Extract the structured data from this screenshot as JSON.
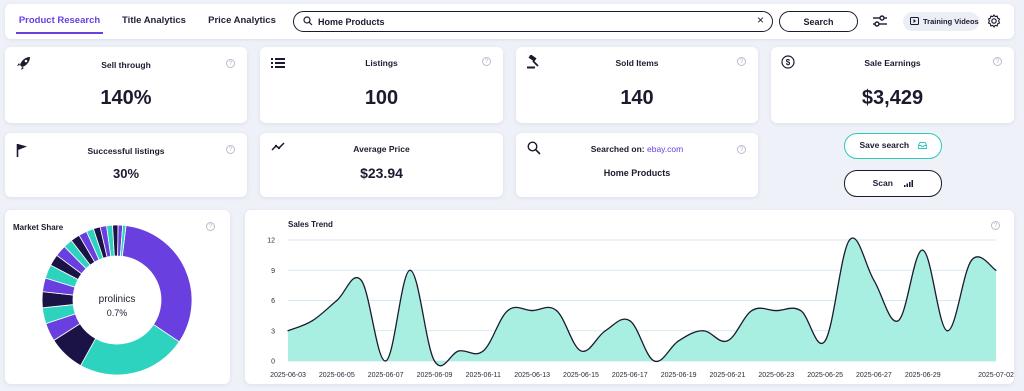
{
  "tabs": [
    {
      "label": "Product Research",
      "active": true
    },
    {
      "label": "Title Analytics",
      "active": false
    },
    {
      "label": "Price Analytics",
      "active": false
    }
  ],
  "search": {
    "value": "Home Products",
    "button_label": "Search"
  },
  "training_label": "Training Videos",
  "stats": {
    "sell_through": {
      "label": "Sell through",
      "value": "140%"
    },
    "listings": {
      "label": "Listings",
      "value": "100"
    },
    "sold_items": {
      "label": "Sold Items",
      "value": "140"
    },
    "sale_earnings": {
      "label": "Sale Earnings",
      "value": "$3,429"
    },
    "successful_listings": {
      "label": "Successful listings",
      "value": "30%"
    },
    "average_price": {
      "label": "Average Price",
      "value": "$23.94"
    },
    "searched_on": {
      "label": "Searched on:",
      "site": "ebay.com",
      "value": "Home Products"
    }
  },
  "save_search_label": "Save search",
  "scan_label": "Scan",
  "help_glyph": "?",
  "market_share": {
    "title": "Market Share",
    "center_name": "prolinics",
    "center_value": "0.7%",
    "slices": [
      {
        "value": 33,
        "color": "#6a3fe0"
      },
      {
        "value": 24,
        "color": "#2ed3bf"
      },
      {
        "value": 8,
        "color": "#1b1346"
      },
      {
        "value": 4,
        "color": "#6a3fe0"
      },
      {
        "value": 3.5,
        "color": "#2ed3bf"
      },
      {
        "value": 3.5,
        "color": "#1b1346"
      },
      {
        "value": 3,
        "color": "#6a3fe0"
      },
      {
        "value": 3,
        "color": "#2ed3bf"
      },
      {
        "value": 2.5,
        "color": "#1b1346"
      },
      {
        "value": 2.5,
        "color": "#6a3fe0"
      },
      {
        "value": 2,
        "color": "#2ed3bf"
      },
      {
        "value": 2,
        "color": "#1b1346"
      },
      {
        "value": 1.8,
        "color": "#6a3fe0"
      },
      {
        "value": 1.6,
        "color": "#2ed3bf"
      },
      {
        "value": 1.5,
        "color": "#1b1346"
      },
      {
        "value": 1.4,
        "color": "#6a3fe0"
      },
      {
        "value": 1.3,
        "color": "#2ed3bf"
      },
      {
        "value": 1.2,
        "color": "#1b1346"
      },
      {
        "value": 1.0,
        "color": "#6a3fe0"
      },
      {
        "value": 0.7,
        "color": "#2ed3bf"
      }
    ]
  },
  "chart_data": {
    "type": "area",
    "title": "Sales Trend",
    "ylim": [
      0,
      12
    ],
    "yticks": [
      0,
      3,
      6,
      9,
      12
    ],
    "grid": true,
    "fill_color": "#a8efe2",
    "line_color": "#1b1b2f",
    "x_labels": [
      "2025-06-03",
      "2025-06-05",
      "2025-06-07",
      "2025-06-09",
      "2025-06-11",
      "2025-06-13",
      "2025-06-15",
      "2025-06-17",
      "2025-06-19",
      "2025-06-21",
      "2025-06-23",
      "2025-06-25",
      "2025-06-27",
      "2025-06-29",
      "2025-07-02"
    ],
    "x": [
      "2025-06-03",
      "2025-06-04",
      "2025-06-05",
      "2025-06-06",
      "2025-06-07",
      "2025-06-08",
      "2025-06-09",
      "2025-06-10",
      "2025-06-11",
      "2025-06-12",
      "2025-06-13",
      "2025-06-14",
      "2025-06-15",
      "2025-06-16",
      "2025-06-17",
      "2025-06-18",
      "2025-06-19",
      "2025-06-20",
      "2025-06-21",
      "2025-06-22",
      "2025-06-23",
      "2025-06-24",
      "2025-06-25",
      "2025-06-26",
      "2025-06-27",
      "2025-06-28",
      "2025-06-29",
      "2025-06-30",
      "2025-07-01",
      "2025-07-02"
    ],
    "values": [
      3,
      4,
      6,
      8,
      0,
      9,
      0,
      1,
      1,
      5,
      5,
      5,
      1,
      3,
      4,
      0,
      2,
      3,
      2,
      5,
      5,
      5,
      2,
      12,
      8,
      4,
      11,
      3,
      10,
      9
    ]
  }
}
